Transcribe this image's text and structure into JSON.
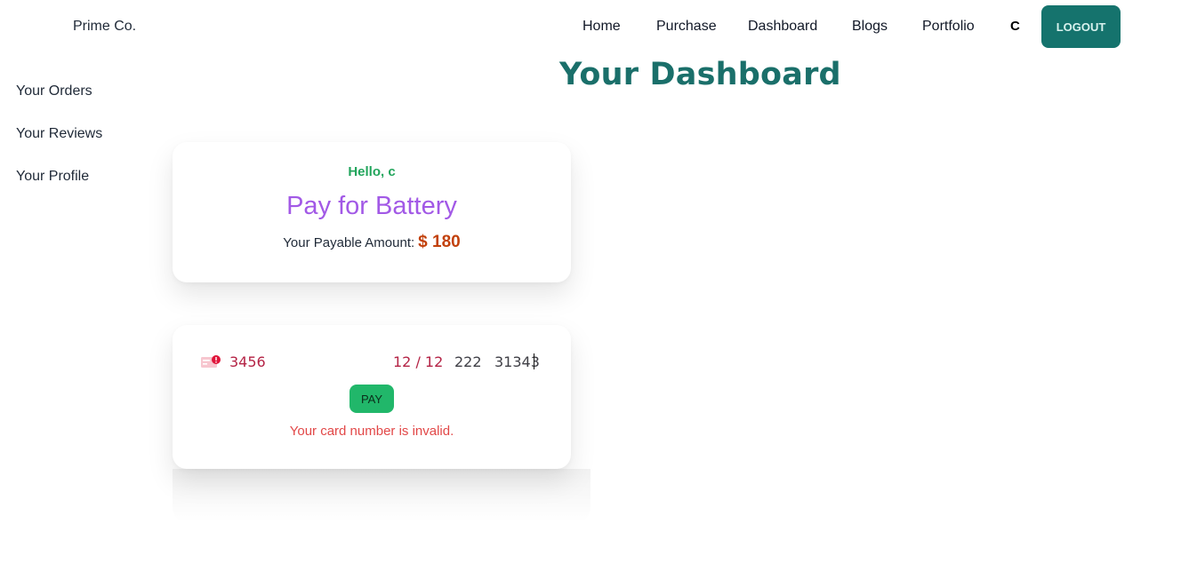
{
  "navbar": {
    "brand": "Prime Co.",
    "links": [
      "Home",
      "Purchase",
      "Dashboard",
      "Blogs",
      "Portfolio"
    ],
    "user_initial": "C",
    "logout_label": "LOGOUT"
  },
  "sidebar": {
    "items": [
      {
        "label": "Your Orders"
      },
      {
        "label": "Your Reviews"
      },
      {
        "label": "Your Profile"
      }
    ]
  },
  "page": {
    "title": "Your Dashboard"
  },
  "order_card": {
    "greeting": "Hello, c",
    "heading": "Pay for Battery",
    "amount_label": "Your Payable Amount:",
    "amount_value": "$ 180"
  },
  "payment_form": {
    "card_icon": "card-error-icon",
    "card_number": "3456",
    "expiry": "12 / 12",
    "cvc": "222",
    "zip": "31343",
    "pay_label": "PAY",
    "error": "Your card number is invalid."
  },
  "colors": {
    "accent": "#15736d",
    "greeting": "#22a55c",
    "heading": "#a259e6",
    "amount": "#c2410c",
    "pay_button": "#21b76a",
    "error": "#e24848"
  }
}
